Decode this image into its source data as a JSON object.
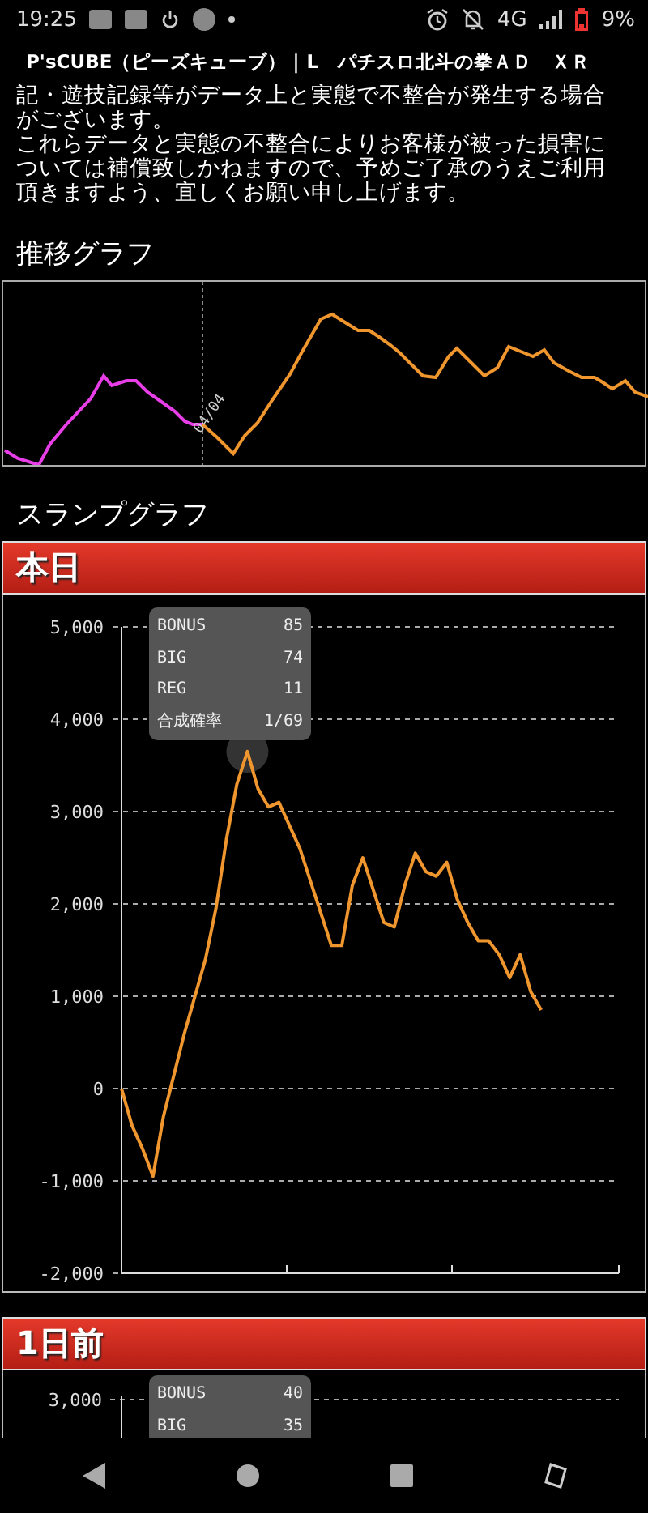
{
  "status_bar": {
    "time": "19:25",
    "network": "4G",
    "battery": "9%"
  },
  "title_bar": {
    "title": "P'sCUBE（ピーズキューブ）｜L　パチスロ北斗の拳ＡＤ　ＸＲ"
  },
  "notice": {
    "lines": [
      "記・遊技記録等がデータ上と実態で不整合が発生する場合",
      "がございます。",
      "これらデータと実態の不整合によりお客様が被った損害に",
      "ついては補償致しかねますので、予めご了承のうえご利用",
      "頂きますよう、宜しくお願い申し上げます。"
    ]
  },
  "trend": {
    "title": "推移グラフ",
    "date_label": "04/04"
  },
  "slump": {
    "title": "スランプグラフ",
    "panels": [
      {
        "header": "本日",
        "tooltip": [
          {
            "label": "BONUS",
            "value": "85"
          },
          {
            "label": "BIG",
            "value": "74"
          },
          {
            "label": "REG",
            "value": "11"
          },
          {
            "label": "合成確率",
            "value": "1/69"
          }
        ],
        "chart_data": {
          "type": "line",
          "categories": [
            null,
            null,
            null,
            null,
            null,
            null,
            null,
            null,
            null,
            null,
            null,
            null,
            null,
            null,
            null,
            null,
            null,
            null,
            null,
            null,
            null,
            null,
            null,
            null,
            null,
            null,
            null,
            null,
            null,
            null,
            null,
            null,
            null,
            null,
            null,
            null,
            null,
            null,
            null,
            null,
            null
          ],
          "series": [
            {
              "color": "#f0962e",
              "values": [
                0,
                -400,
                -650,
                -950,
                -300,
                150,
                600,
                1000,
                1400,
                1950,
                2700,
                3300,
                3650,
                3250,
                3050,
                3100,
                2850,
                2600,
                2250,
                1900,
                1550,
                1550,
                2200,
                2500,
                2150,
                1800,
                1750,
                2200,
                2550,
                2350,
                2300,
                2450,
                2050,
                1800,
                1600,
                1600,
                1450,
                1200,
                1450,
                1050,
                850
              ]
            }
          ],
          "ylim": [
            -2000,
            5000
          ],
          "grid": true,
          "yticks": [
            {
              "value": 5000,
              "label": "5,000"
            },
            {
              "value": 4000,
              "label": "4,000"
            },
            {
              "value": 3000,
              "label": "3,000"
            },
            {
              "value": 2000,
              "label": "2,000"
            },
            {
              "value": 1000,
              "label": "1,000"
            },
            {
              "value": 0,
              "label": "0"
            },
            {
              "value": -1000,
              "label": "-1,000"
            },
            {
              "value": -2000,
              "label": "-2,000"
            }
          ]
        }
      },
      {
        "header": "1日前",
        "tooltip": [
          {
            "label": "BONUS",
            "value": "40"
          },
          {
            "label": "BIG",
            "value": "35"
          }
        ],
        "ytick_labels": [
          "3,000"
        ]
      }
    ]
  }
}
